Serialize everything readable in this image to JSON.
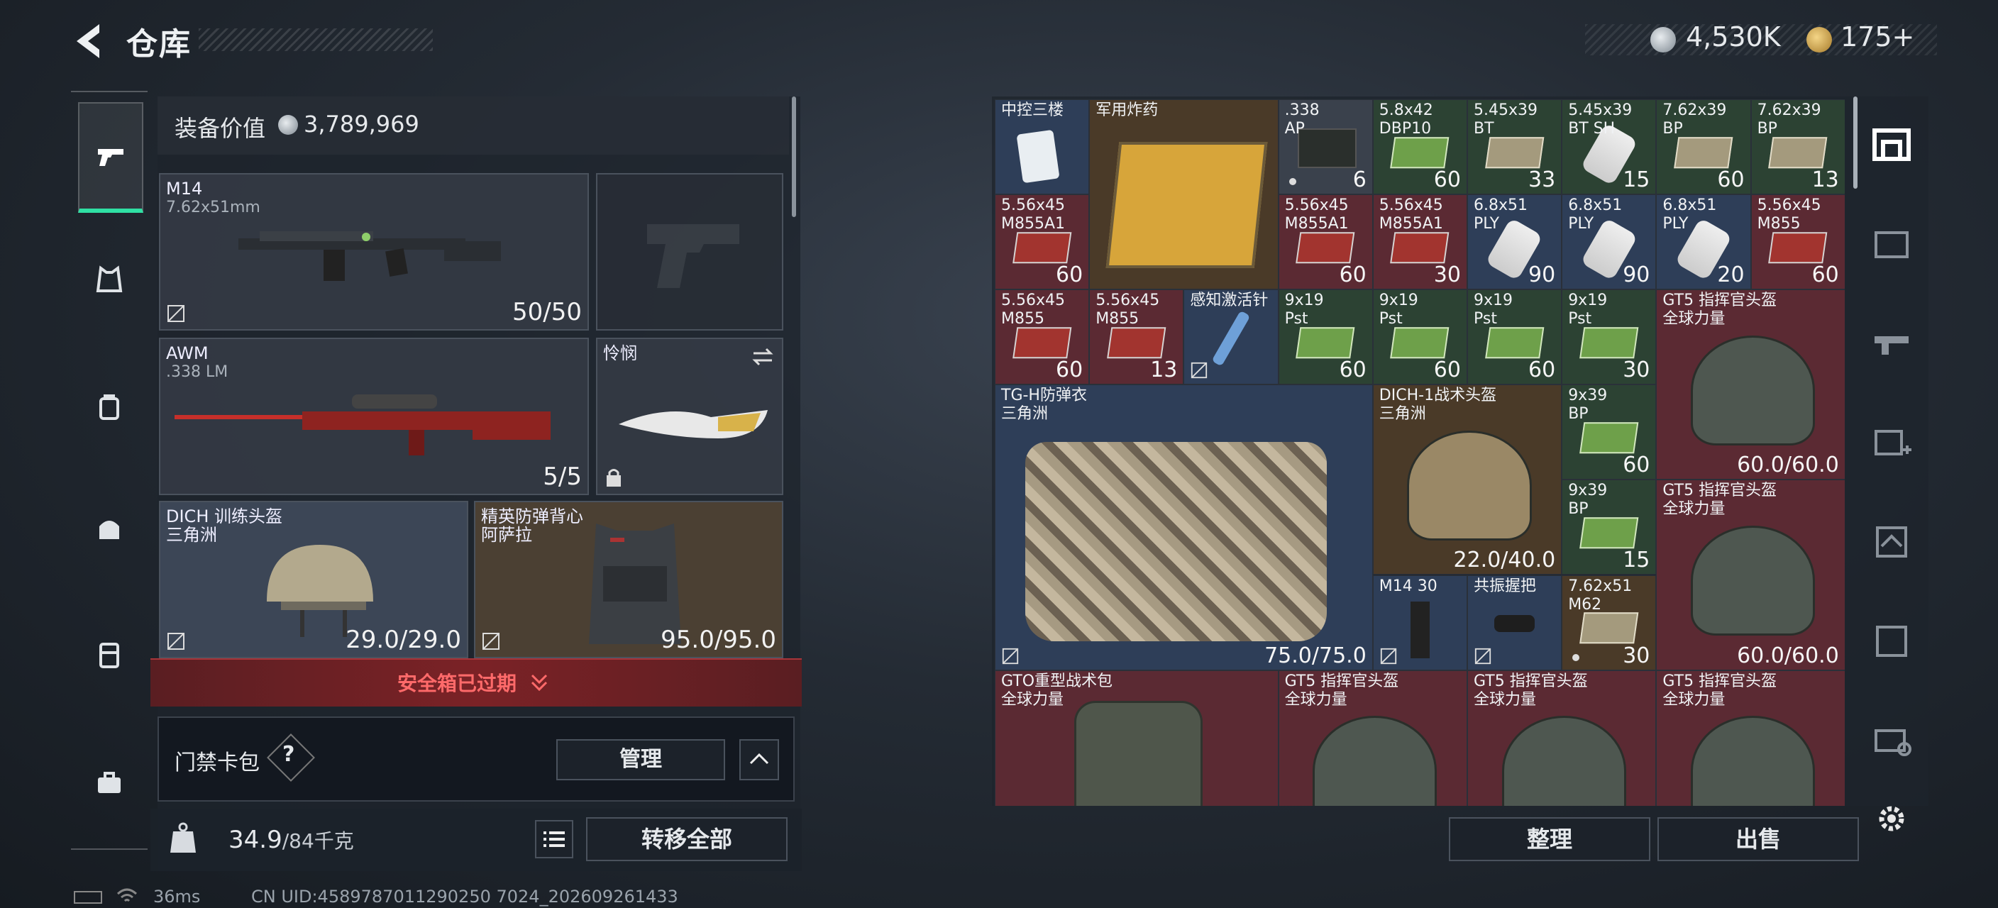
{
  "header": {
    "title": "仓库",
    "currency_silver": "4,530K",
    "currency_gold": "175+"
  },
  "loadout": {
    "value_label": "装备价值",
    "value": "3,789,969",
    "primary": {
      "name": "M14",
      "caliber": "7.62x51mm",
      "ammo": "50/50"
    },
    "secondary": {
      "name": "AWM",
      "caliber": ".338 LM",
      "ammo": "5/5"
    },
    "melee": {
      "name": "怜悯"
    },
    "helmet": {
      "name": "DICH 训练头盔",
      "origin": "三角洲",
      "durability": "29.0/29.0"
    },
    "armor": {
      "name": "精英防弹背心",
      "origin": "阿萨拉",
      "durability": "95.0/95.0"
    }
  },
  "safe_box_banner": "安全箱已过期",
  "keycard": {
    "label": "门禁卡包",
    "help": "?",
    "manage_label": "管理"
  },
  "footer": {
    "weight": "34.9",
    "weight_max": "/84千克",
    "transfer_label": "转移全部",
    "sort_label": "整理",
    "sell_label": "出售"
  },
  "status": {
    "ping": "36ms",
    "uid": "CN UID:4589787011290250 7024_202609261433"
  },
  "storage_items": [
    {
      "name": "中控三楼",
      "qty": ""
    },
    {
      "name": "军用炸药",
      "qty": ""
    },
    {
      "name": ".338\nAP",
      "qty": "6"
    },
    {
      "name": "5.8x42\nDBP10",
      "qty": "60"
    },
    {
      "name": "5.45x39\nBT",
      "qty": "33"
    },
    {
      "name": "5.45x39\nBT SH",
      "qty": "15"
    },
    {
      "name": "7.62x39\nBP",
      "qty": "60"
    },
    {
      "name": "7.62x39\nBP",
      "qty": "13"
    },
    {
      "name": "5.56x45\nM855A1",
      "qty": "60"
    },
    {
      "name": "5.56x45\nM855A1",
      "qty": "60"
    },
    {
      "name": "5.56x45\nM855A1",
      "qty": "30"
    },
    {
      "name": "6.8x51\nPLY",
      "qty": "90"
    },
    {
      "name": "6.8x51\nPLY",
      "qty": "90"
    },
    {
      "name": "6.8x51\nPLY",
      "qty": "20"
    },
    {
      "name": "5.56x45\nM855",
      "qty": "60"
    },
    {
      "name": "5.56x45\nM855",
      "qty": "60"
    },
    {
      "name": "5.56x45\nM855",
      "qty": "13"
    },
    {
      "name": "感知激活针",
      "qty": ""
    },
    {
      "name": "9x19\nPst",
      "qty": "60"
    },
    {
      "name": "9x19\nPst",
      "qty": "60"
    },
    {
      "name": "9x19\nPst",
      "qty": "60"
    },
    {
      "name": "9x19\nPst",
      "qty": "30"
    },
    {
      "name": "GT5 指挥官头盔\n全球力量",
      "qty": ""
    },
    {
      "name": "TG-H防弹衣\n三角洲",
      "qty": "75.0/75.0"
    },
    {
      "name": "DICH-1战术头盔\n三角洲",
      "qty": "22.0/40.0"
    },
    {
      "name": "9x39\nBP",
      "qty": "60"
    },
    {
      "name": "",
      "qty": "60.0/60.0"
    },
    {
      "name": "9x39\nBP",
      "qty": "15"
    },
    {
      "name": "GT5 指挥官头盔\n全球力量",
      "qty": "60.0/60.0"
    },
    {
      "name": "M14 30",
      "qty": ""
    },
    {
      "name": "共振握把",
      "qty": ""
    },
    {
      "name": "7.62x51\nM62",
      "qty": "30"
    },
    {
      "name": "GTO重型战术包\n全球力量",
      "qty": ""
    },
    {
      "name": "GT5 指挥官头盔\n全球力量",
      "qty": ""
    },
    {
      "name": "GT5 指挥官头盔\n全球力量",
      "qty": ""
    },
    {
      "name": "GT5 指挥官头盔\n全球力量",
      "qty": ""
    }
  ]
}
